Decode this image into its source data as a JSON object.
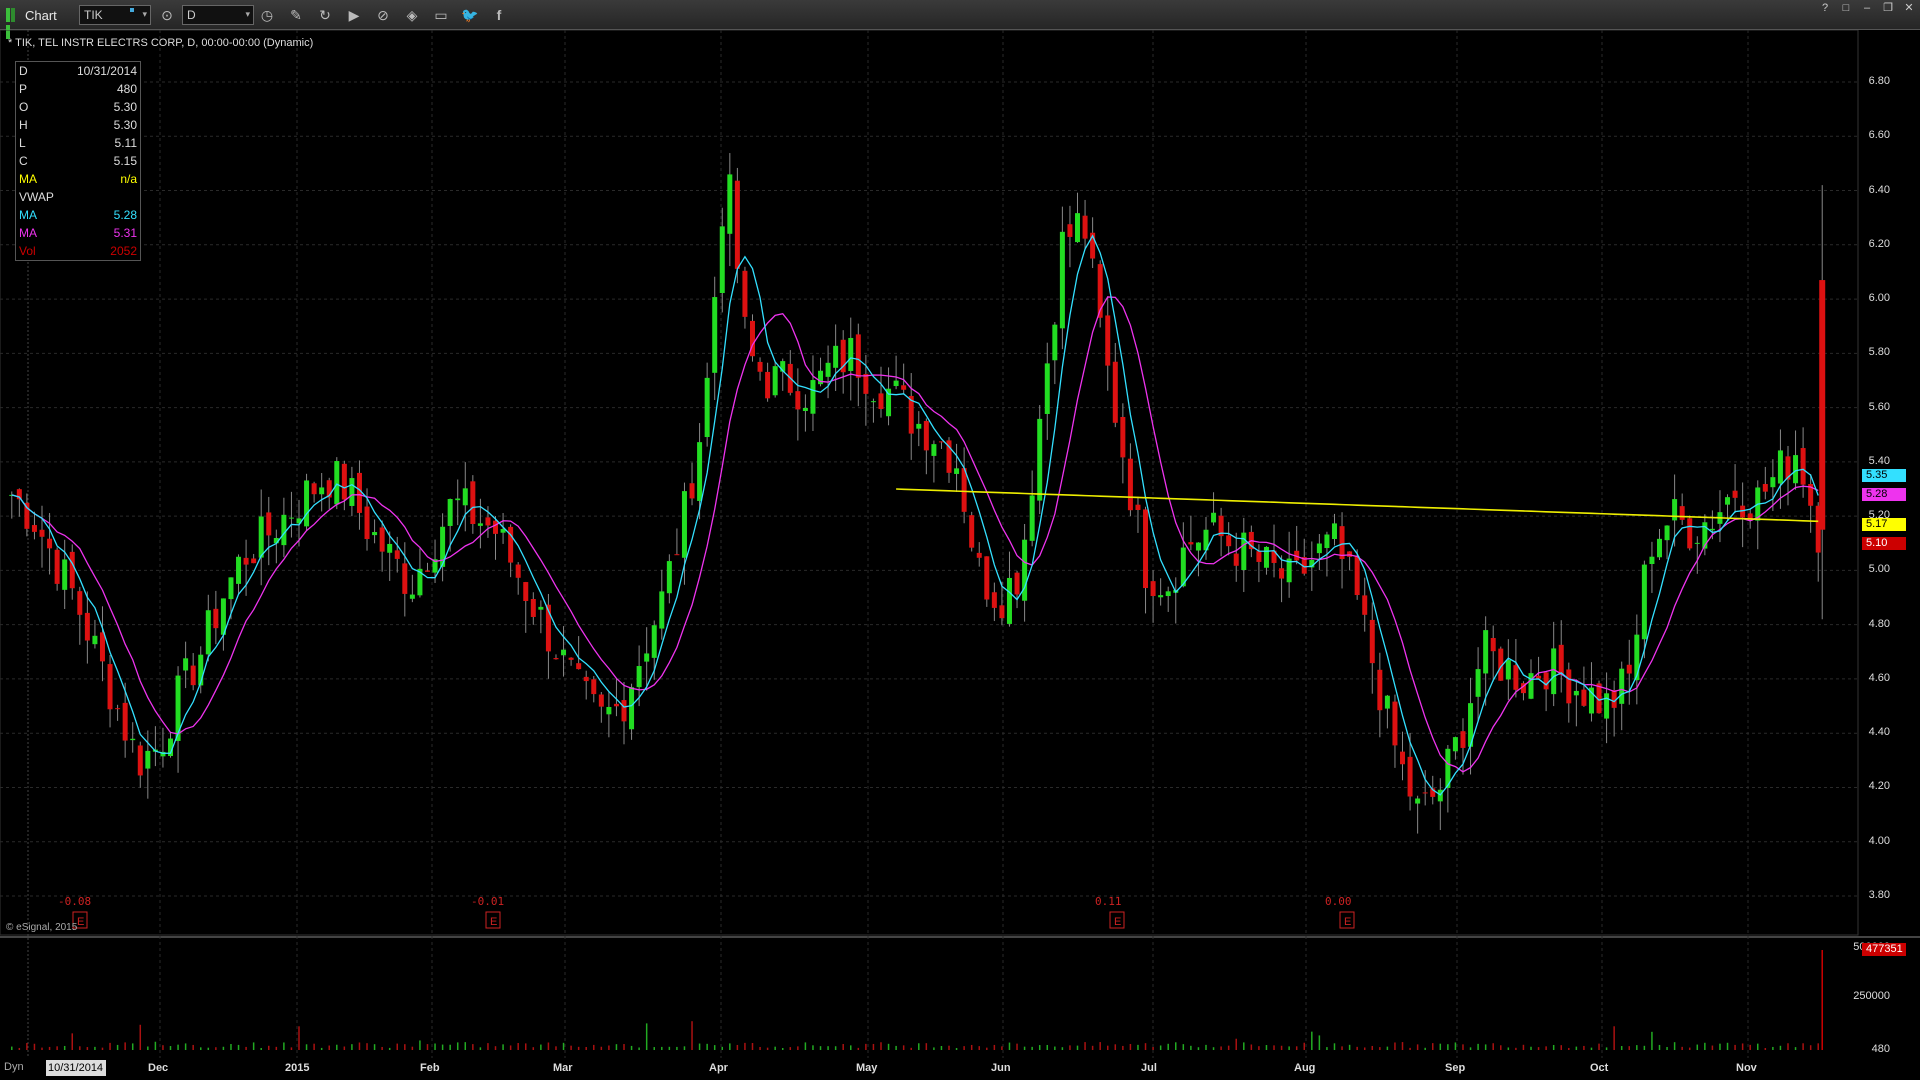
{
  "titlebar": {
    "title": "Chart",
    "symbol": "TIK",
    "interval": "D",
    "icons": [
      "link-icon",
      "pencil-icon",
      "refresh-icon",
      "play-icon",
      "zoom-icon",
      "tag-icon",
      "chat-icon",
      "twitter-icon",
      "facebook-icon"
    ],
    "window_buttons": [
      "?",
      "□",
      "–",
      "❐",
      "✕"
    ]
  },
  "chart_header": "* TIK, TEL INSTR ELECTRS CORP, D, 00:00-00:00 (Dynamic)",
  "data_window": [
    {
      "label": "D",
      "value": "10/31/2014",
      "color": "#dddddd"
    },
    {
      "label": "P",
      "value": "480",
      "color": "#dddddd"
    },
    {
      "label": "O",
      "value": "5.30",
      "color": "#dddddd"
    },
    {
      "label": "H",
      "value": "5.30",
      "color": "#dddddd"
    },
    {
      "label": "L",
      "value": "5.11",
      "color": "#dddddd"
    },
    {
      "label": "C",
      "value": "5.15",
      "color": "#dddddd"
    },
    {
      "label": "MA",
      "value": "n/a",
      "color": "#ffff00"
    },
    {
      "label": "VWAP",
      "value": "",
      "color": "#dddddd"
    },
    {
      "label": "MA",
      "value": "5.28",
      "color": "#33e0ff"
    },
    {
      "label": "MA",
      "value": "5.31",
      "color": "#ee33ee"
    },
    {
      "label": "Vol",
      "value": "2052",
      "color": "#cc0000"
    }
  ],
  "watermark": "© eSignal, 2015",
  "price_axis": [
    "6.80",
    "6.60",
    "6.40",
    "6.20",
    "6.00",
    "5.80",
    "5.60",
    "5.40",
    "5.20",
    "5.00",
    "4.80",
    "4.60",
    "4.40",
    "4.20",
    "4.00",
    "3.80"
  ],
  "price_tags": [
    {
      "value": "5.35",
      "color": "#33e0ff",
      "price": 5.35
    },
    {
      "value": "5.28",
      "color": "#ee33ee",
      "price": 5.28
    },
    {
      "value": "5.17",
      "color": "#ffff00",
      "price": 5.17
    },
    {
      "value": "5.10",
      "color": "#cc0000",
      "price": 5.1
    }
  ],
  "earnings": [
    {
      "label": "-0.08",
      "x_month": "Nov"
    },
    {
      "label": "-0.01",
      "x_month": "Feb"
    },
    {
      "label": "0.11",
      "x_month": "Jun"
    },
    {
      "label": "0.00",
      "x_month": "Aug"
    }
  ],
  "earnings_icon_label": "E",
  "volume_axis": [
    "500000",
    "250000",
    "480"
  ],
  "volume_tag": "477351",
  "bottom": {
    "dyn": "Dyn",
    "date": "10/31/2014",
    "months": [
      "Dec",
      "2015",
      "Feb",
      "Mar",
      "Apr",
      "May",
      "Jun",
      "Jul",
      "Aug",
      "Sep",
      "Oct",
      "Nov"
    ]
  },
  "chart_data": {
    "type": "candlestick",
    "ylim": [
      3.8,
      6.9
    ],
    "title": "",
    "close_path": [
      5.28,
      5.2,
      5.05,
      4.9,
      4.7,
      4.5,
      4.3,
      4.35,
      4.55,
      4.7,
      4.9,
      5.05,
      5.12,
      5.2,
      5.28,
      5.35,
      5.3,
      5.15,
      5.05,
      4.95,
      5.1,
      5.25,
      5.2,
      5.15,
      5.0,
      4.85,
      4.7,
      4.55,
      4.45,
      4.5,
      4.7,
      4.9,
      5.2,
      5.6,
      6.5,
      5.8,
      5.7,
      5.7,
      5.65,
      5.75,
      5.8,
      5.7,
      5.65,
      5.55,
      5.5,
      5.4,
      5.0,
      4.9,
      5.0,
      5.6,
      6.2,
      6.3,
      5.8,
      5.4,
      5.0,
      4.95,
      5.1,
      5.15,
      5.1,
      5.05,
      5.0,
      4.95,
      5.05,
      5.1,
      4.9,
      4.6,
      4.3,
      4.1,
      4.2,
      4.4,
      4.7,
      4.65,
      4.6,
      4.65,
      4.6,
      4.55,
      4.5,
      4.6,
      5.1,
      5.2,
      5.15,
      5.2,
      5.3,
      5.25,
      5.35,
      5.45,
      5.15
    ],
    "volume_spike": 477351
  }
}
